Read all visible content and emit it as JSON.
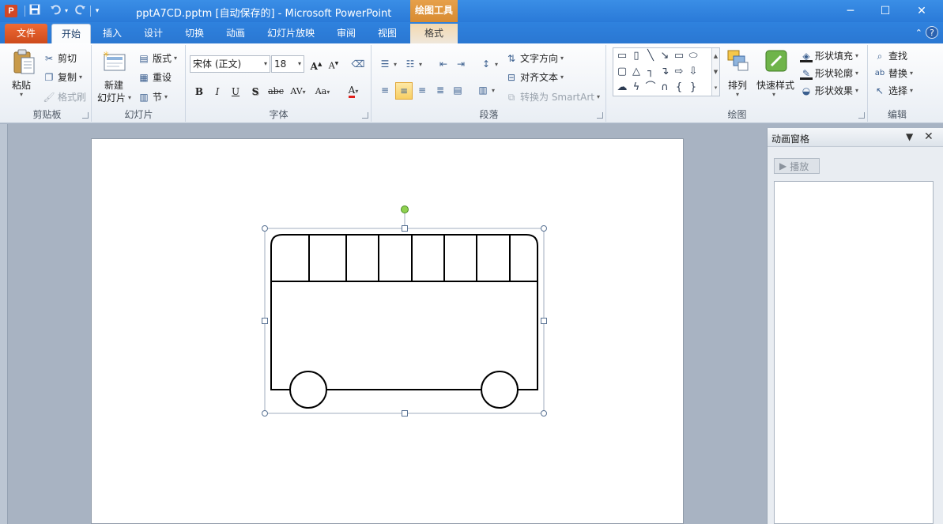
{
  "app": {
    "title": "pptA7CD.pptm [自动保存的] - Microsoft PowerPoint",
    "icon_letter": "P",
    "context_tab_header": "绘图工具",
    "colors": {
      "titlebar": "#2a7ad8",
      "file_tab": "#d24726",
      "context": "#e6a04a"
    }
  },
  "quick_access": [
    {
      "name": "save-icon",
      "glyph": "💾"
    },
    {
      "name": "undo-icon",
      "glyph": "↶"
    },
    {
      "name": "redo-icon",
      "glyph": "↻"
    },
    {
      "name": "customize-icon",
      "glyph": "▾"
    }
  ],
  "window_controls": {
    "minimize": "─",
    "maximize": "☐",
    "close": "✕"
  },
  "tabs": {
    "file": "文件",
    "home": "开始",
    "insert": "插入",
    "design": "设计",
    "transitions": "切换",
    "animations": "动画",
    "slideshow": "幻灯片放映",
    "review": "审阅",
    "view": "视图",
    "format": "格式"
  },
  "ribbon": {
    "clipboard": {
      "label": "剪贴板",
      "paste": "粘贴",
      "cut": "剪切",
      "copy": "复制",
      "format_painter": "格式刷"
    },
    "slides": {
      "label": "幻灯片",
      "new_slide_line1": "新建",
      "new_slide_line2": "幻灯片",
      "layout": "版式",
      "reset": "重设",
      "section": "节"
    },
    "font": {
      "label": "字体",
      "font_name": "宋体 (正文)",
      "font_size": "18",
      "grow": "A",
      "shrink": "A",
      "bold": "B",
      "italic": "I",
      "underline": "U",
      "shadow": "S",
      "strike": "abc",
      "spacing": "AV",
      "case": "Aa",
      "color": "A"
    },
    "paragraph": {
      "label": "段落",
      "text_direction": "文字方向",
      "align_text": "对齐文本",
      "smartart": "转换为 SmartArt"
    },
    "drawing": {
      "label": "绘图",
      "arrange": "排列",
      "quick_styles": "快速样式",
      "shape_fill": "形状填充",
      "shape_outline": "形状轮廓",
      "shape_effects": "形状效果"
    },
    "editing": {
      "label": "编辑",
      "find": "查找",
      "replace": "替换",
      "select": "选择"
    }
  },
  "animation_pane": {
    "title": "动画窗格",
    "play": "播放"
  }
}
